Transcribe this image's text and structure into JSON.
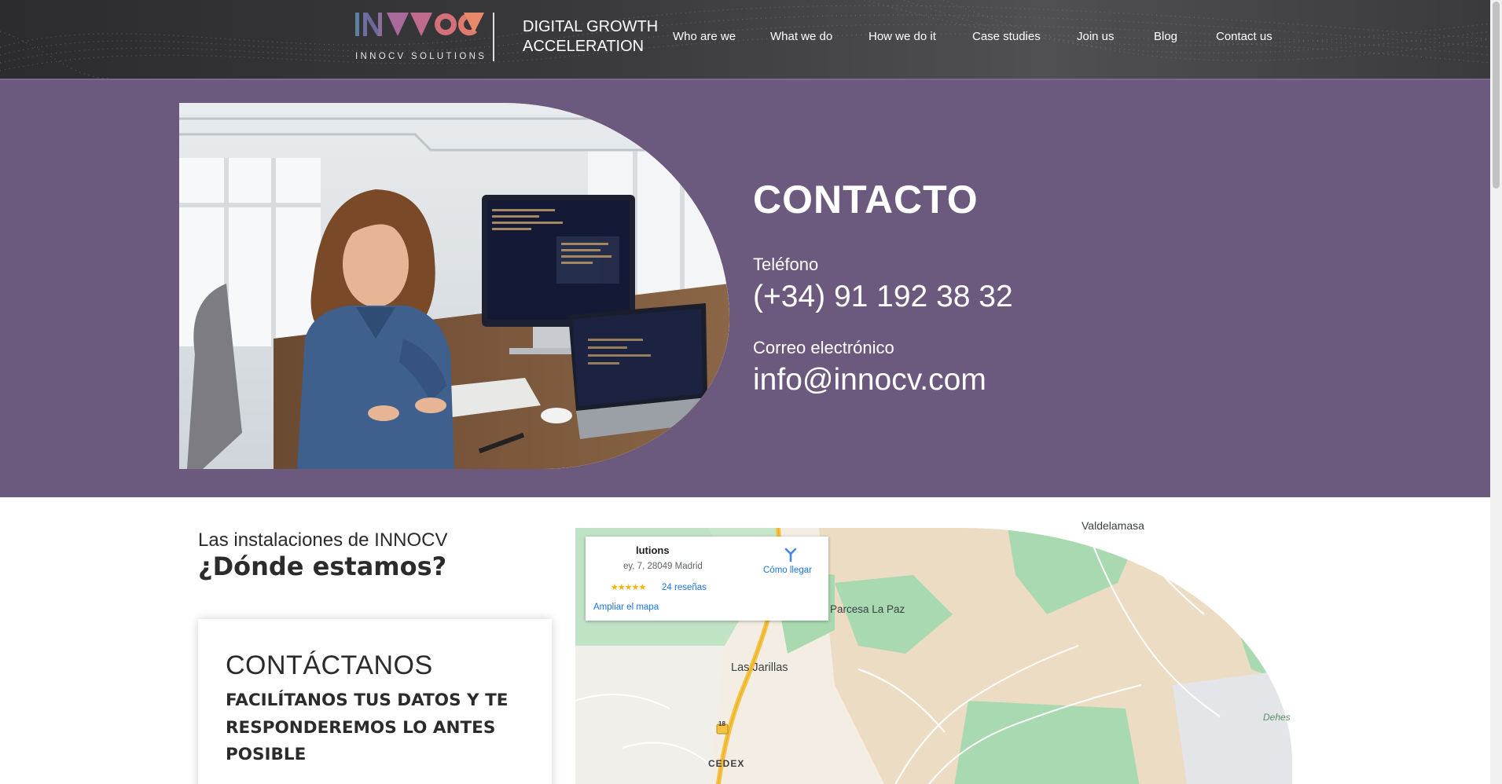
{
  "header": {
    "logo_text": "INNOCV SOLUTIONS",
    "tagline_line1": "DIGITAL GROWTH",
    "tagline_line2": "ACCELERATION",
    "nav": [
      {
        "label": "Who are we"
      },
      {
        "label": "What we do"
      },
      {
        "label": "How we do it"
      },
      {
        "label": "Case studies"
      },
      {
        "label": "Join us"
      },
      {
        "label": "Blog"
      },
      {
        "label": "Contact us"
      }
    ]
  },
  "hero": {
    "title": "CONTACTO",
    "phone_label": "Teléfono",
    "phone": "(+34) 91 192 38 32",
    "email_label": "Correo electrónico",
    "email": "info@innocv.com"
  },
  "location": {
    "subtitle": "Las instalaciones de INNOCV",
    "title": "¿Dónde estamos?"
  },
  "contact_card": {
    "title": "CONTÁCTANOS",
    "text": "FACILÍTANOS TUS DATOS Y TE RESPONDEREMOS LO ANTES POSIBLE"
  },
  "map": {
    "place_name": "lutions",
    "address": "ey, 7, 28049 Madrid",
    "stars": "★★★★★",
    "reviews": "24 reseñas",
    "enlarge": "Ampliar el mapa",
    "directions": "Cómo llegar",
    "labels": {
      "valdelamasa": "Valdelamasa",
      "parcesa": "Parcesa La Paz",
      "jarillas": "Las Jarillas",
      "dehesa": "Dehes",
      "cedex": "CEDEX",
      "road": "18"
    }
  },
  "colors": {
    "hero_bg": "#6b5a7e",
    "header_bg": "#3a3a3c",
    "text_dark": "#2b2b2b",
    "link_blue": "#1a73e8"
  }
}
